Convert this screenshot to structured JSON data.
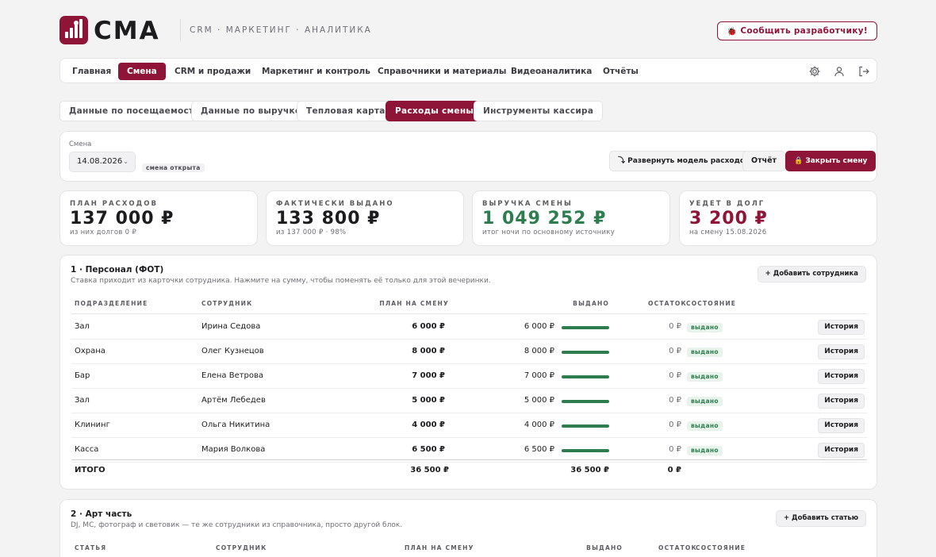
{
  "brand": {
    "name": "СМА",
    "subtitle": "CRM · МАРКЕТИНГ · АНАЛИТИКА",
    "report_button": "Сообщить разработчику!"
  },
  "nav": {
    "items": [
      "Главная",
      "Смена",
      "CRM и продажи",
      "Маркетинг и контроль",
      "Справочники и материалы",
      "Видеоаналитика",
      "Отчёты"
    ],
    "active": "Смена",
    "icons": [
      "gear-icon",
      "user-icon",
      "logout-icon"
    ]
  },
  "subtabs": {
    "items": [
      "Данные по посещаемости",
      "Данные по выручке",
      "Тепловая карта",
      "Расходы смены",
      "Инструменты кассира"
    ],
    "active": "Расходы смены"
  },
  "shift": {
    "label": "Смена",
    "date": "14.08.2026",
    "status": "смена открыта",
    "expand_button": "⤵ Развернуть модель расходов",
    "report_button": "Отчёт",
    "close_button": "🔒 Закрыть смену"
  },
  "kpis": [
    {
      "caption": "ПЛАН РАСХОДОВ",
      "value": "137 000 ₽",
      "note": "из них долгов 0 ₽",
      "color": "#1c1c1e"
    },
    {
      "caption": "ФАКТИЧЕСКИ ВЫДАНО",
      "value": "133 800 ₽",
      "note": "из 137 000 ₽ · 98%",
      "color": "#1c1c1e"
    },
    {
      "caption": "ВЫРУЧКА СМЕНЫ",
      "value": "1 049 252 ₽",
      "note": "итог ночи по основному источнику",
      "color": "#2e7d4f"
    },
    {
      "caption": "УЕДЕТ В ДОЛГ",
      "value": "3 200 ₽",
      "note": "на смену 15.08.2026",
      "color": "#8e1538"
    }
  ],
  "section1": {
    "title": "1 · Персонал (ФОТ)",
    "description": "Ставка приходит из карточки сотрудника. Нажмите на сумму, чтобы поменять её только для этой вечеринки.",
    "add_button": "+ Добавить сотрудника",
    "headers": {
      "department": "ПОДРАЗДЕЛЕНИЕ",
      "employee": "СОТРУДНИК",
      "plan": "ПЛАН НА СМЕНУ",
      "issued": "ВЫДАНО",
      "remaining": "ОСТАТОК",
      "state": "СОСТОЯНИЕ"
    },
    "rows": [
      {
        "department": "Зал",
        "employee": "Ирина Седова",
        "plan": "6 000 ₽",
        "issued": "6 000 ₽",
        "remaining": "0 ₽",
        "state": "выдано",
        "progress": 1.0,
        "history": "История"
      },
      {
        "department": "Охрана",
        "employee": "Олег Кузнецов",
        "plan": "8 000 ₽",
        "issued": "8 000 ₽",
        "remaining": "0 ₽",
        "state": "выдано",
        "progress": 1.0,
        "history": "История"
      },
      {
        "department": "Бар",
        "employee": "Елена Ветрова",
        "plan": "7 000 ₽",
        "issued": "7 000 ₽",
        "remaining": "0 ₽",
        "state": "выдано",
        "progress": 1.0,
        "history": "История"
      },
      {
        "department": "Зал",
        "employee": "Артём Лебедев",
        "plan": "5 000 ₽",
        "issued": "5 000 ₽",
        "remaining": "0 ₽",
        "state": "выдано",
        "progress": 1.0,
        "history": "История"
      },
      {
        "department": "Клининг",
        "employee": "Ольга Никитина",
        "plan": "4 000 ₽",
        "issued": "4 000 ₽",
        "remaining": "0 ₽",
        "state": "выдано",
        "progress": 1.0,
        "history": "История"
      },
      {
        "department": "Касса",
        "employee": "Мария Волкова",
        "plan": "6 500 ₽",
        "issued": "6 500 ₽",
        "remaining": "0 ₽",
        "state": "выдано",
        "progress": 1.0,
        "history": "История"
      }
    ],
    "total": {
      "label": "ИТОГО",
      "plan": "36 500 ₽",
      "issued": "36 500 ₽",
      "remaining": "0 ₽"
    }
  },
  "section2": {
    "title": "2 · Арт часть",
    "description": "DJ, МС, фотограф и световик — те же сотрудники из справочника, просто другой блок.",
    "add_button": "+ Добавить статью",
    "headers": {
      "item": "СТАТЬЯ",
      "employee": "СОТРУДНИК",
      "plan": "ПЛАН НА СМЕНУ",
      "issued": "ВЫДАНО",
      "remaining": "ОСТАТОК",
      "state": "СОСТОЯНИЕ"
    }
  },
  "colors": {
    "accent": "#8e1538",
    "success": "#2e7d4f",
    "background": "#f3f3f4"
  }
}
